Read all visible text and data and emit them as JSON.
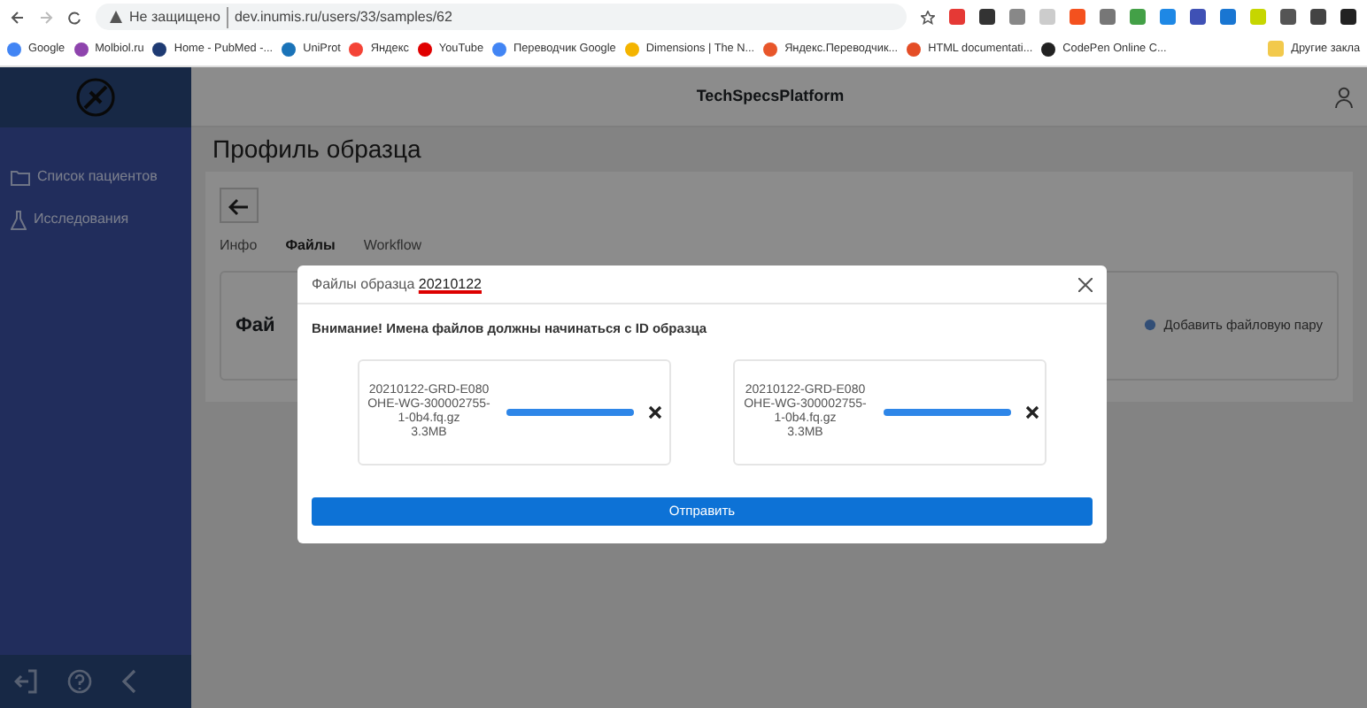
{
  "browser": {
    "security": "Не защищено",
    "url": "dev.inumis.ru/users/33/samples/62",
    "bookmarks": [
      {
        "label": "Google",
        "color": "#4285f4"
      },
      {
        "label": "Molbiol.ru",
        "color": "#8e44ad"
      },
      {
        "label": "Home - PubMed -...",
        "color": "#1f3b73"
      },
      {
        "label": "UniProt",
        "color": "#1a73b8"
      },
      {
        "label": "Яндекс",
        "color": "#f44336"
      },
      {
        "label": "YouTube",
        "color": "#e00000"
      },
      {
        "label": "Переводчик Google",
        "color": "#4285f4"
      },
      {
        "label": "Dimensions | The N...",
        "color": "#f4b400"
      },
      {
        "label": "Яндекс.Переводчик...",
        "color": "#e8562a"
      },
      {
        "label": "HTML documentati...",
        "color": "#e44d26"
      },
      {
        "label": "CodePen Online C...",
        "color": "#222222"
      }
    ],
    "other_bookmarks": "Другие закла"
  },
  "app": {
    "title": "TechSpecsPlatform",
    "sidebar": {
      "items": [
        {
          "label": "Список пациентов",
          "kind": "patients"
        },
        {
          "label": "Исследования",
          "kind": "research"
        }
      ]
    },
    "page_title": "Профиль образца",
    "tabs": [
      {
        "label": "Инфо",
        "selected": false
      },
      {
        "label": "Файлы",
        "selected": true
      },
      {
        "label": "Workflow",
        "selected": false
      }
    ],
    "section_title": "Фай",
    "add_button": "Добавить файловую пару"
  },
  "modal": {
    "title": "Файлы образца",
    "sample_id": "20210122",
    "warning": "Внимание! Имена файлов должны начинаться с ID образца",
    "files": [
      {
        "name": "20210122-GRD-E080OHE-WG-300002755-1-0b4.fq.gz",
        "size": "3.3MB",
        "level": 1
      },
      {
        "name": "20210122-GRD-E080OHE-WG-300002755-1-0b4.fq.gz",
        "size": "3.3MB",
        "level": 1
      }
    ],
    "submit": "Отправить"
  }
}
